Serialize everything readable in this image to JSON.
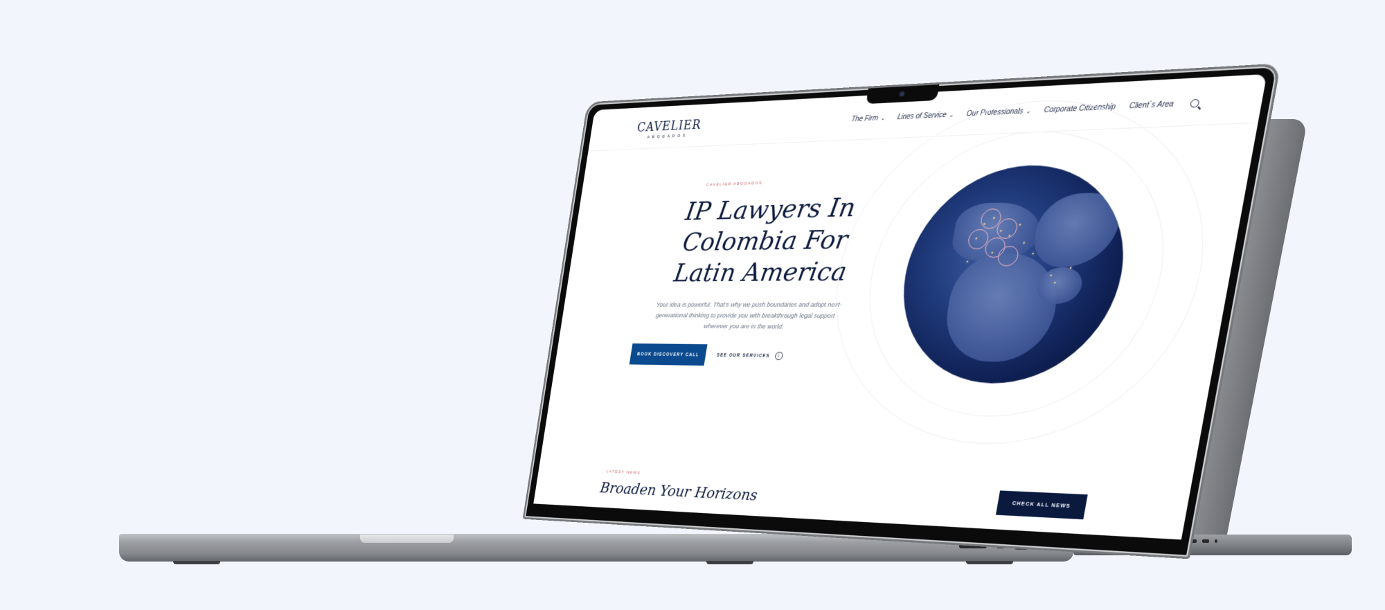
{
  "nav": {
    "logo_name": "CAVELIER",
    "logo_sub": "ABOGADOS",
    "items": [
      {
        "label": "The Firm",
        "has_dropdown": true
      },
      {
        "label": "Lines of Service",
        "has_dropdown": true
      },
      {
        "label": "Our Professionals",
        "has_dropdown": true
      },
      {
        "label": "Corporate Citizenship",
        "has_dropdown": false
      },
      {
        "label": "Client´s Area",
        "has_dropdown": false
      }
    ],
    "search_icon": "search-icon"
  },
  "hero": {
    "eyebrow": "CAVELIER ABOGADOS",
    "title": "IP Lawyers In Colombia For Latin America",
    "subtitle": "Your idea is powerful. That's why we push boundaries and adopt next-generational thinking to provide you with breakthrough legal support - wherever you are in the world.",
    "primary_cta": "BOOK DISCOVERY CALL",
    "secondary_cta": "SEE OUR SERVICES"
  },
  "news": {
    "eyebrow": "LATEST NEWS",
    "title": "Broaden Your Horizons",
    "button": "CHECK ALL NEWS"
  },
  "colors": {
    "page_background": "#f2f6fc",
    "brand_navy": "#0d1b3e",
    "primary_blue": "#0b4a8f",
    "accent_pink": "#d4606a"
  }
}
